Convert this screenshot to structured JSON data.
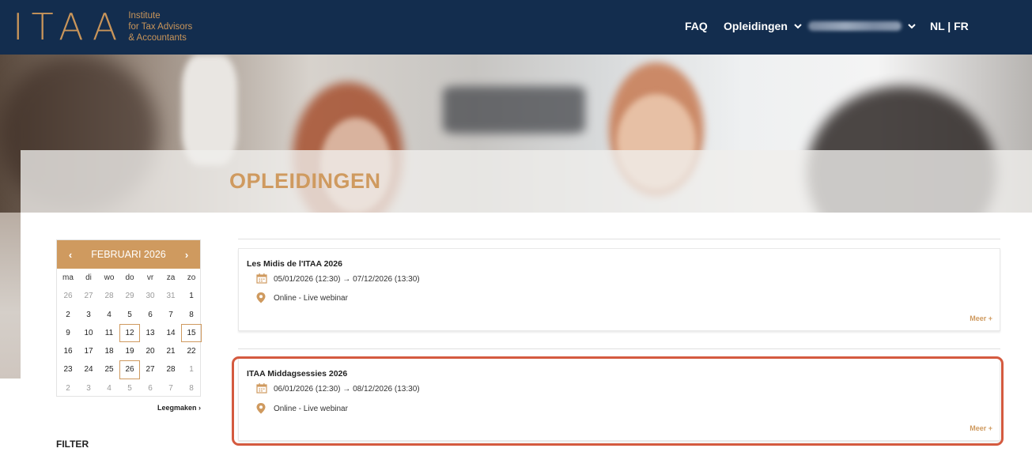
{
  "header": {
    "logo_mark": "ITAA",
    "logo_lines": [
      "Institute",
      "for Tax Advisors",
      "& Accountants"
    ],
    "nav": {
      "faq": "FAQ",
      "opleidingen": "Opleidingen",
      "lang": "NL | FR"
    }
  },
  "hero": {
    "title": "OPLEIDINGEN"
  },
  "calendar": {
    "prev": "‹",
    "next": "›",
    "month_label": "FEBRUARI 2026",
    "weekdays": [
      "ma",
      "di",
      "wo",
      "do",
      "vr",
      "za",
      "zo"
    ],
    "days": [
      {
        "d": "26",
        "m": true
      },
      {
        "d": "27",
        "m": true
      },
      {
        "d": "28",
        "m": true
      },
      {
        "d": "29",
        "m": true
      },
      {
        "d": "30",
        "m": true
      },
      {
        "d": "31",
        "m": true
      },
      {
        "d": "1"
      },
      {
        "d": "2"
      },
      {
        "d": "3"
      },
      {
        "d": "4"
      },
      {
        "d": "5"
      },
      {
        "d": "6"
      },
      {
        "d": "7"
      },
      {
        "d": "8"
      },
      {
        "d": "9"
      },
      {
        "d": "10"
      },
      {
        "d": "11"
      },
      {
        "d": "12",
        "marked": true
      },
      {
        "d": "13"
      },
      {
        "d": "14"
      },
      {
        "d": "15",
        "marked": true
      },
      {
        "d": "16"
      },
      {
        "d": "17"
      },
      {
        "d": "18"
      },
      {
        "d": "19"
      },
      {
        "d": "20"
      },
      {
        "d": "21"
      },
      {
        "d": "22"
      },
      {
        "d": "23"
      },
      {
        "d": "24"
      },
      {
        "d": "25"
      },
      {
        "d": "26",
        "marked": true
      },
      {
        "d": "27"
      },
      {
        "d": "28"
      },
      {
        "d": "1",
        "m": true
      },
      {
        "d": "2",
        "m": true
      },
      {
        "d": "3",
        "m": true
      },
      {
        "d": "4",
        "m": true
      },
      {
        "d": "5",
        "m": true
      },
      {
        "d": "6",
        "m": true
      },
      {
        "d": "7",
        "m": true
      },
      {
        "d": "8",
        "m": true
      }
    ],
    "clear_label": "Leegmaken",
    "clear_arrow": "›"
  },
  "filter": {
    "label": "FILTER"
  },
  "courses": [
    {
      "title": "Les Midis de l'ITAA 2026",
      "dates": "05/01/2026 (12:30) → 07/12/2026 (13:30)",
      "location": "Online - Live webinar",
      "more": "Meer +"
    },
    {
      "title": "ITAA Middagsessies 2026",
      "dates": "06/01/2026 (12:30) → 08/12/2026 (13:30)",
      "location": "Online - Live webinar",
      "more": "Meer +"
    }
  ],
  "colors": {
    "header_bg": "#132d4e",
    "accent": "#cf9a5f",
    "highlight": "#d45a3f"
  },
  "icons": {
    "calendar": "calendar-icon",
    "location": "map-pin-icon",
    "chevron": "chevron-down-icon"
  }
}
